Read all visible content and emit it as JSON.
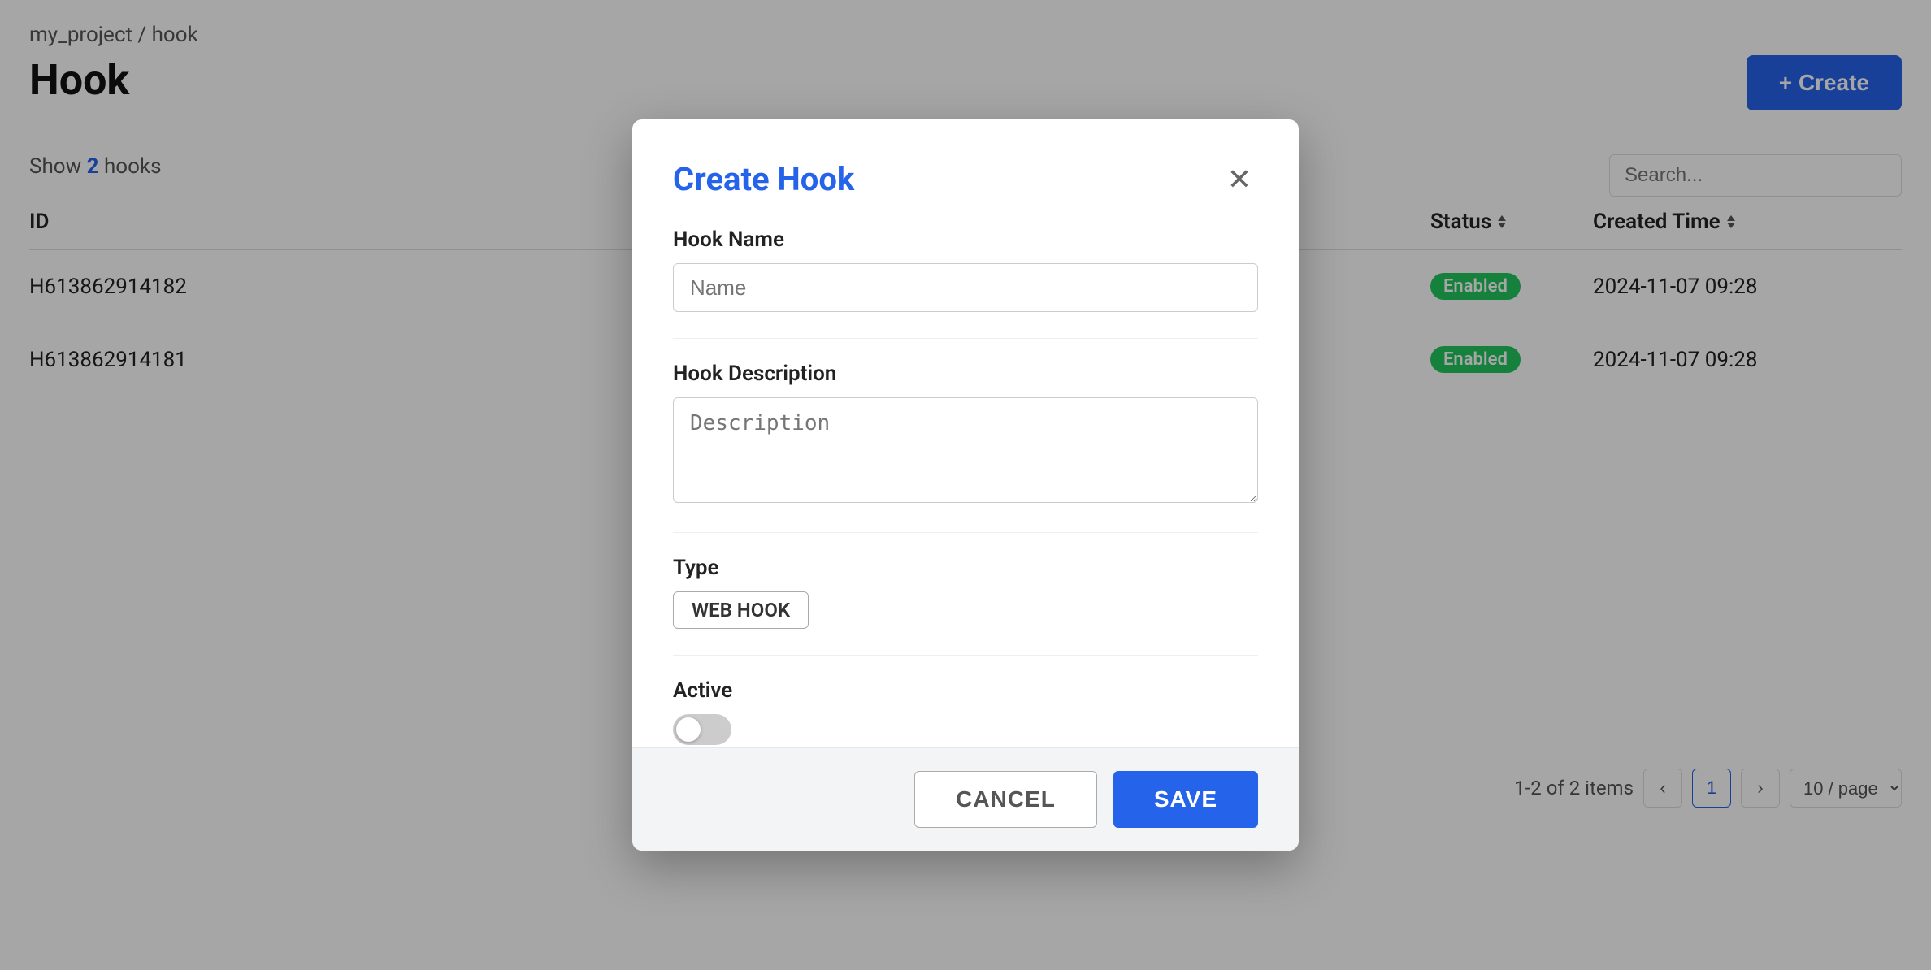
{
  "breadcrumb": {
    "project": "my_project",
    "separator": "/",
    "section": "hook"
  },
  "page": {
    "title": "Hook",
    "show_label": "Show",
    "count": "2",
    "hooks_label": "hooks"
  },
  "create_button": "+ Create",
  "search": {
    "placeholder": "Search..."
  },
  "table": {
    "columns": [
      "ID",
      "Status",
      "Created Time"
    ],
    "status_sort_label": "Status",
    "time_sort_label": "Created Time",
    "rows": [
      {
        "id": "H613862914182",
        "status": "Enabled",
        "time": "2024-11-07 09:28"
      },
      {
        "id": "H613862914181",
        "status": "Enabled",
        "time": "2024-11-07 09:28"
      }
    ]
  },
  "pagination": {
    "info": "1-2 of 2 items",
    "current_page": "1",
    "per_page": "10 / page"
  },
  "modal": {
    "title": "Create Hook",
    "hook_name_label": "Hook Name",
    "name_placeholder": "Name",
    "description_label": "Hook Description",
    "description_placeholder": "Description",
    "type_label": "Type",
    "type_badge": "WEB HOOK",
    "active_label": "Active",
    "cancel_label": "CANCEL",
    "save_label": "SAVE"
  }
}
